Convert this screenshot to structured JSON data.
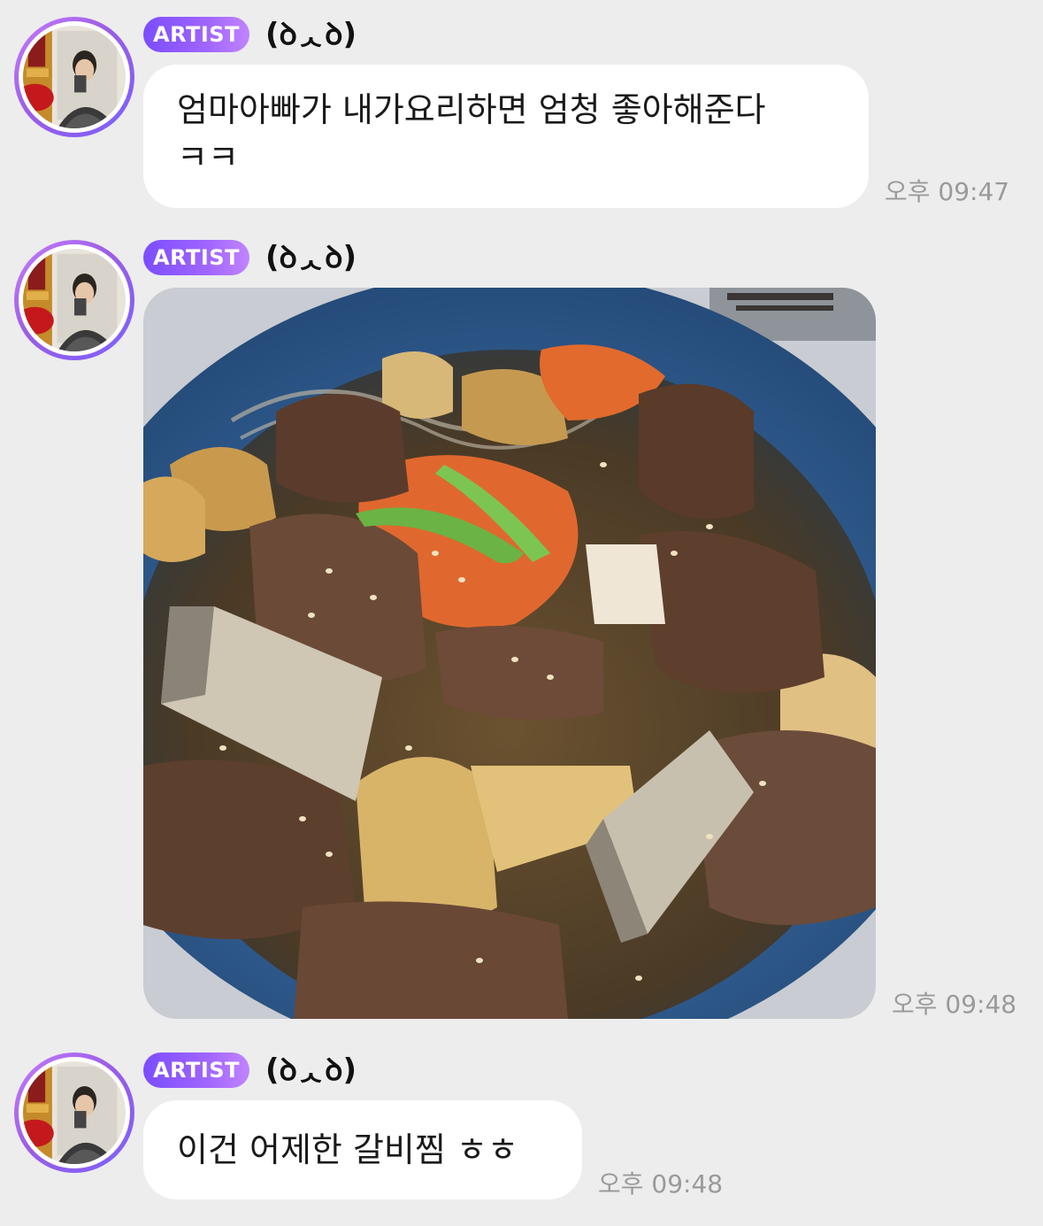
{
  "messages": [
    {
      "badge": "ARTIST",
      "sender": "(ꝺᆺꝺ)",
      "text_line1": "엄마아빠가 내가요리하면 엄청 좋아해준다",
      "text_line2": "ㅋㅋ",
      "time": "오후 09:47"
    },
    {
      "badge": "ARTIST",
      "sender": "(ꝺᆺꝺ)",
      "time": "오후 09:48"
    },
    {
      "badge": "ARTIST",
      "sender": "(ꝺᆺꝺ)",
      "text": "이건 어제한 갈비찜 ㅎㅎ",
      "time": "오후 09:48"
    }
  ],
  "colors": {
    "background": "#ededed",
    "bubble": "#ffffff",
    "badge_start": "#7b4dff",
    "badge_end": "#c184ff",
    "timestamp": "#9a9a9a"
  }
}
